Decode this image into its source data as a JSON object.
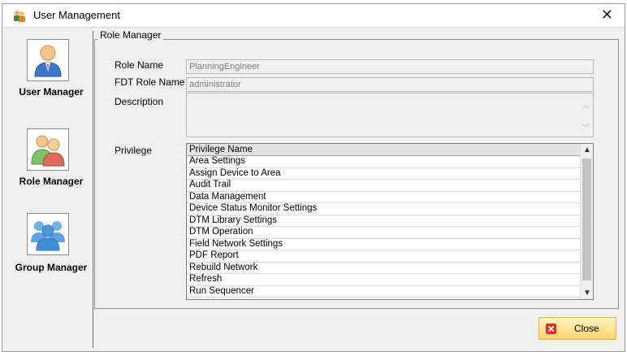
{
  "window": {
    "title": "User Management"
  },
  "sidebar": {
    "items": [
      {
        "label": "User Manager",
        "icon": "user-icon"
      },
      {
        "label": "Role Manager",
        "icon": "role-icon"
      },
      {
        "label": "Group Manager",
        "icon": "group-icon"
      }
    ]
  },
  "role_manager": {
    "group_title": "Role Manager",
    "role_name_label": "Role Name",
    "role_name_value": "PlanningEngineer",
    "fdt_role_label": "FDT Role Name",
    "fdt_role_value": "administrator",
    "description_label": "Description",
    "description_value": "",
    "privilege_label": "Privilege",
    "privilege_header": "Privilege Name",
    "privileges": [
      "Area Settings",
      "Assign Device to Area",
      "Audit Trail",
      "Data Management",
      "Device Status Monitor Settings",
      "DTM Library Settings",
      "DTM Operation",
      "Field Network Settings",
      "PDF Report",
      "Rebuild Network",
      "Refresh",
      "Run Sequencer"
    ]
  },
  "footer": {
    "close_label": "Close"
  },
  "colors": {
    "window_bg": "#f0f0f0",
    "button_gradient_top": "#fff3c2",
    "button_gradient_bottom": "#ffd66e",
    "close_icon_red": "#d9322c"
  }
}
